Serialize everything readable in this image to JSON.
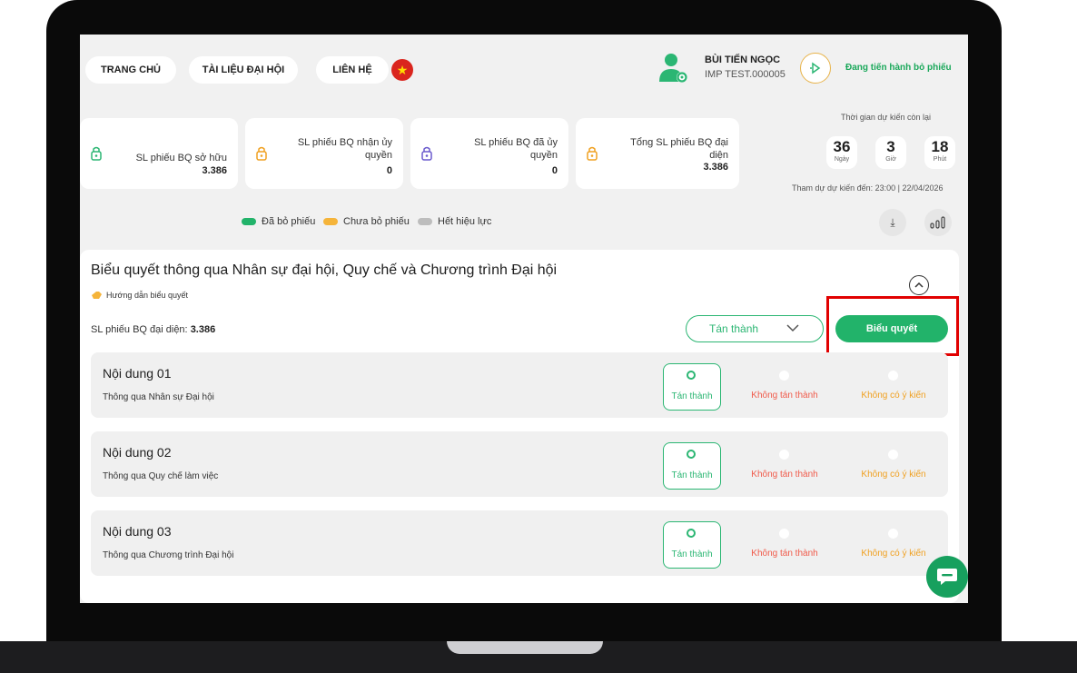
{
  "nav": {
    "home": "TRANG CHỦ",
    "documents": "TÀI LIỆU ĐẠI HỘI",
    "contact": "LIÊN HỆ",
    "user_name": "BÙI TIẾN NGỌC",
    "user_code": "IMP TEST.000005",
    "status": "Đang tiến hành bỏ phiếu"
  },
  "stats": [
    {
      "label_1": "SL phiếu BQ sở hữu",
      "label_2": "",
      "value": "3.386"
    },
    {
      "label_1": "SL phiếu BQ nhận ủy",
      "label_2": "quyền",
      "value": "0"
    },
    {
      "label_1": "SL phiếu BQ đã ủy",
      "label_2": "quyền",
      "value": "0"
    },
    {
      "label_1": "Tổng SL phiếu BQ đại",
      "label_2": "diện",
      "value": "3.386"
    }
  ],
  "countdown": {
    "title": "Thời gian dự kiến còn lại",
    "days": "36",
    "days_unit": "Ngày",
    "hours": "3",
    "hours_unit": "Giờ",
    "minutes": "18",
    "minutes_unit": "Phút",
    "attend": "Tham dự dự kiến đến: 23:00 | 22/04/2026"
  },
  "legend": {
    "voted": "Đã bỏ phiếu",
    "not_voted": "Chưa bỏ phiếu",
    "expired": "Hết hiệu lực"
  },
  "colors": {
    "accent": "#22b36a",
    "pending": "#f5b43a",
    "expired": "#bdbdbd",
    "reject": "#f05a4a",
    "abstain": "#f0a020",
    "highlight": "#e10000"
  },
  "panel": {
    "title": "Biểu quyết thông qua Nhân sự đại hội, Quy chế và Chương trình Đại hội",
    "guide": "Hướng dẫn biểu quyết",
    "rep_label": "SL phiếu BQ đại diện:",
    "rep_value": "3.386",
    "approve_select": "Tán thành",
    "vote_button": "Biểu quyết"
  },
  "items": [
    {
      "title": "Nội dung 01",
      "desc": "Thông qua Nhân sự Đại hội",
      "yes": "Tán thành",
      "no": "Không tán thành",
      "abstain": "Không có ý kiến"
    },
    {
      "title": "Nội dung 02",
      "desc": "Thông qua Quy chế làm việc",
      "yes": "Tán thành",
      "no": "Không tán thành",
      "abstain": "Không có ý kiến"
    },
    {
      "title": "Nội dung 03",
      "desc": "Thông qua Chương trình Đại hội",
      "yes": "Tán thành",
      "no": "Không tán thành",
      "abstain": "Không có ý kiến"
    }
  ]
}
